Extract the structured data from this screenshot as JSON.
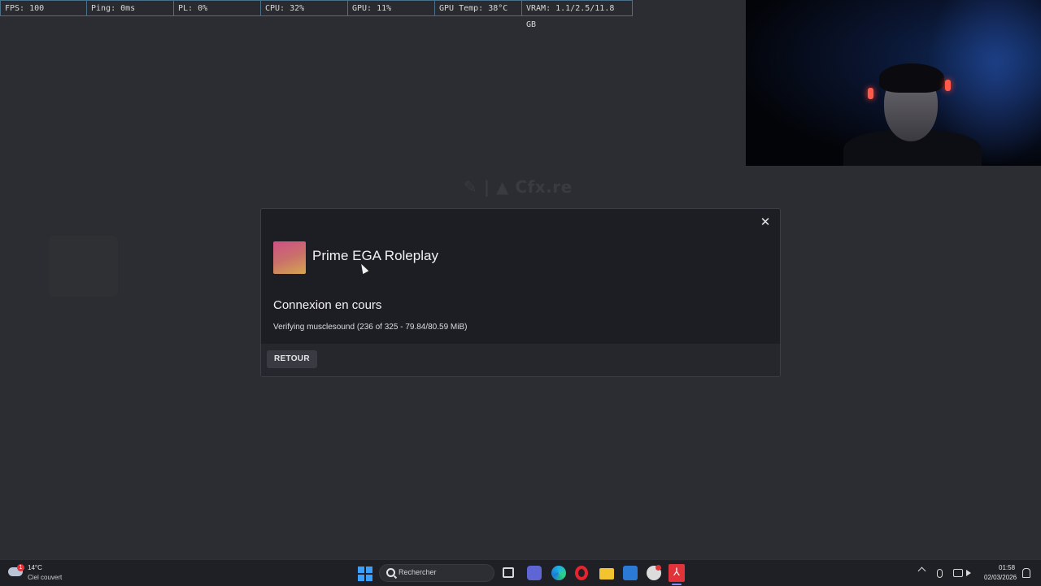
{
  "overlay": {
    "stats": [
      {
        "text": "FPS: 100",
        "width": 107
      },
      {
        "text": "Ping: 0ms",
        "width": 107
      },
      {
        "text": "PL: 0%",
        "width": 107
      },
      {
        "text": "CPU: 32%",
        "width": 107
      },
      {
        "text": "GPU: 11%",
        "width": 107
      },
      {
        "text": "GPU Temp: 38°C",
        "width": 107
      },
      {
        "text": "VRAM: 1.1/2.5/11.8 GB",
        "width": 134
      }
    ]
  },
  "background": {
    "logo_text": "✎ | ▲ Cfx.re"
  },
  "modal": {
    "close_glyph": "✕",
    "server_name": "Prime EGA Roleplay",
    "status_title": "Connexion en cours",
    "status_detail": "Verifying musclesound (236 of 325 - 79.84/80.59 MiB)",
    "back_label": "RETOUR"
  },
  "taskbar": {
    "weather": {
      "badge": "1",
      "temp": "14°C",
      "desc": "Ciel couvert"
    },
    "search_placeholder": "Rechercher",
    "fivem_glyph": "⅄",
    "clock": {
      "time": "01:58",
      "date": "02/03/2026"
    }
  }
}
